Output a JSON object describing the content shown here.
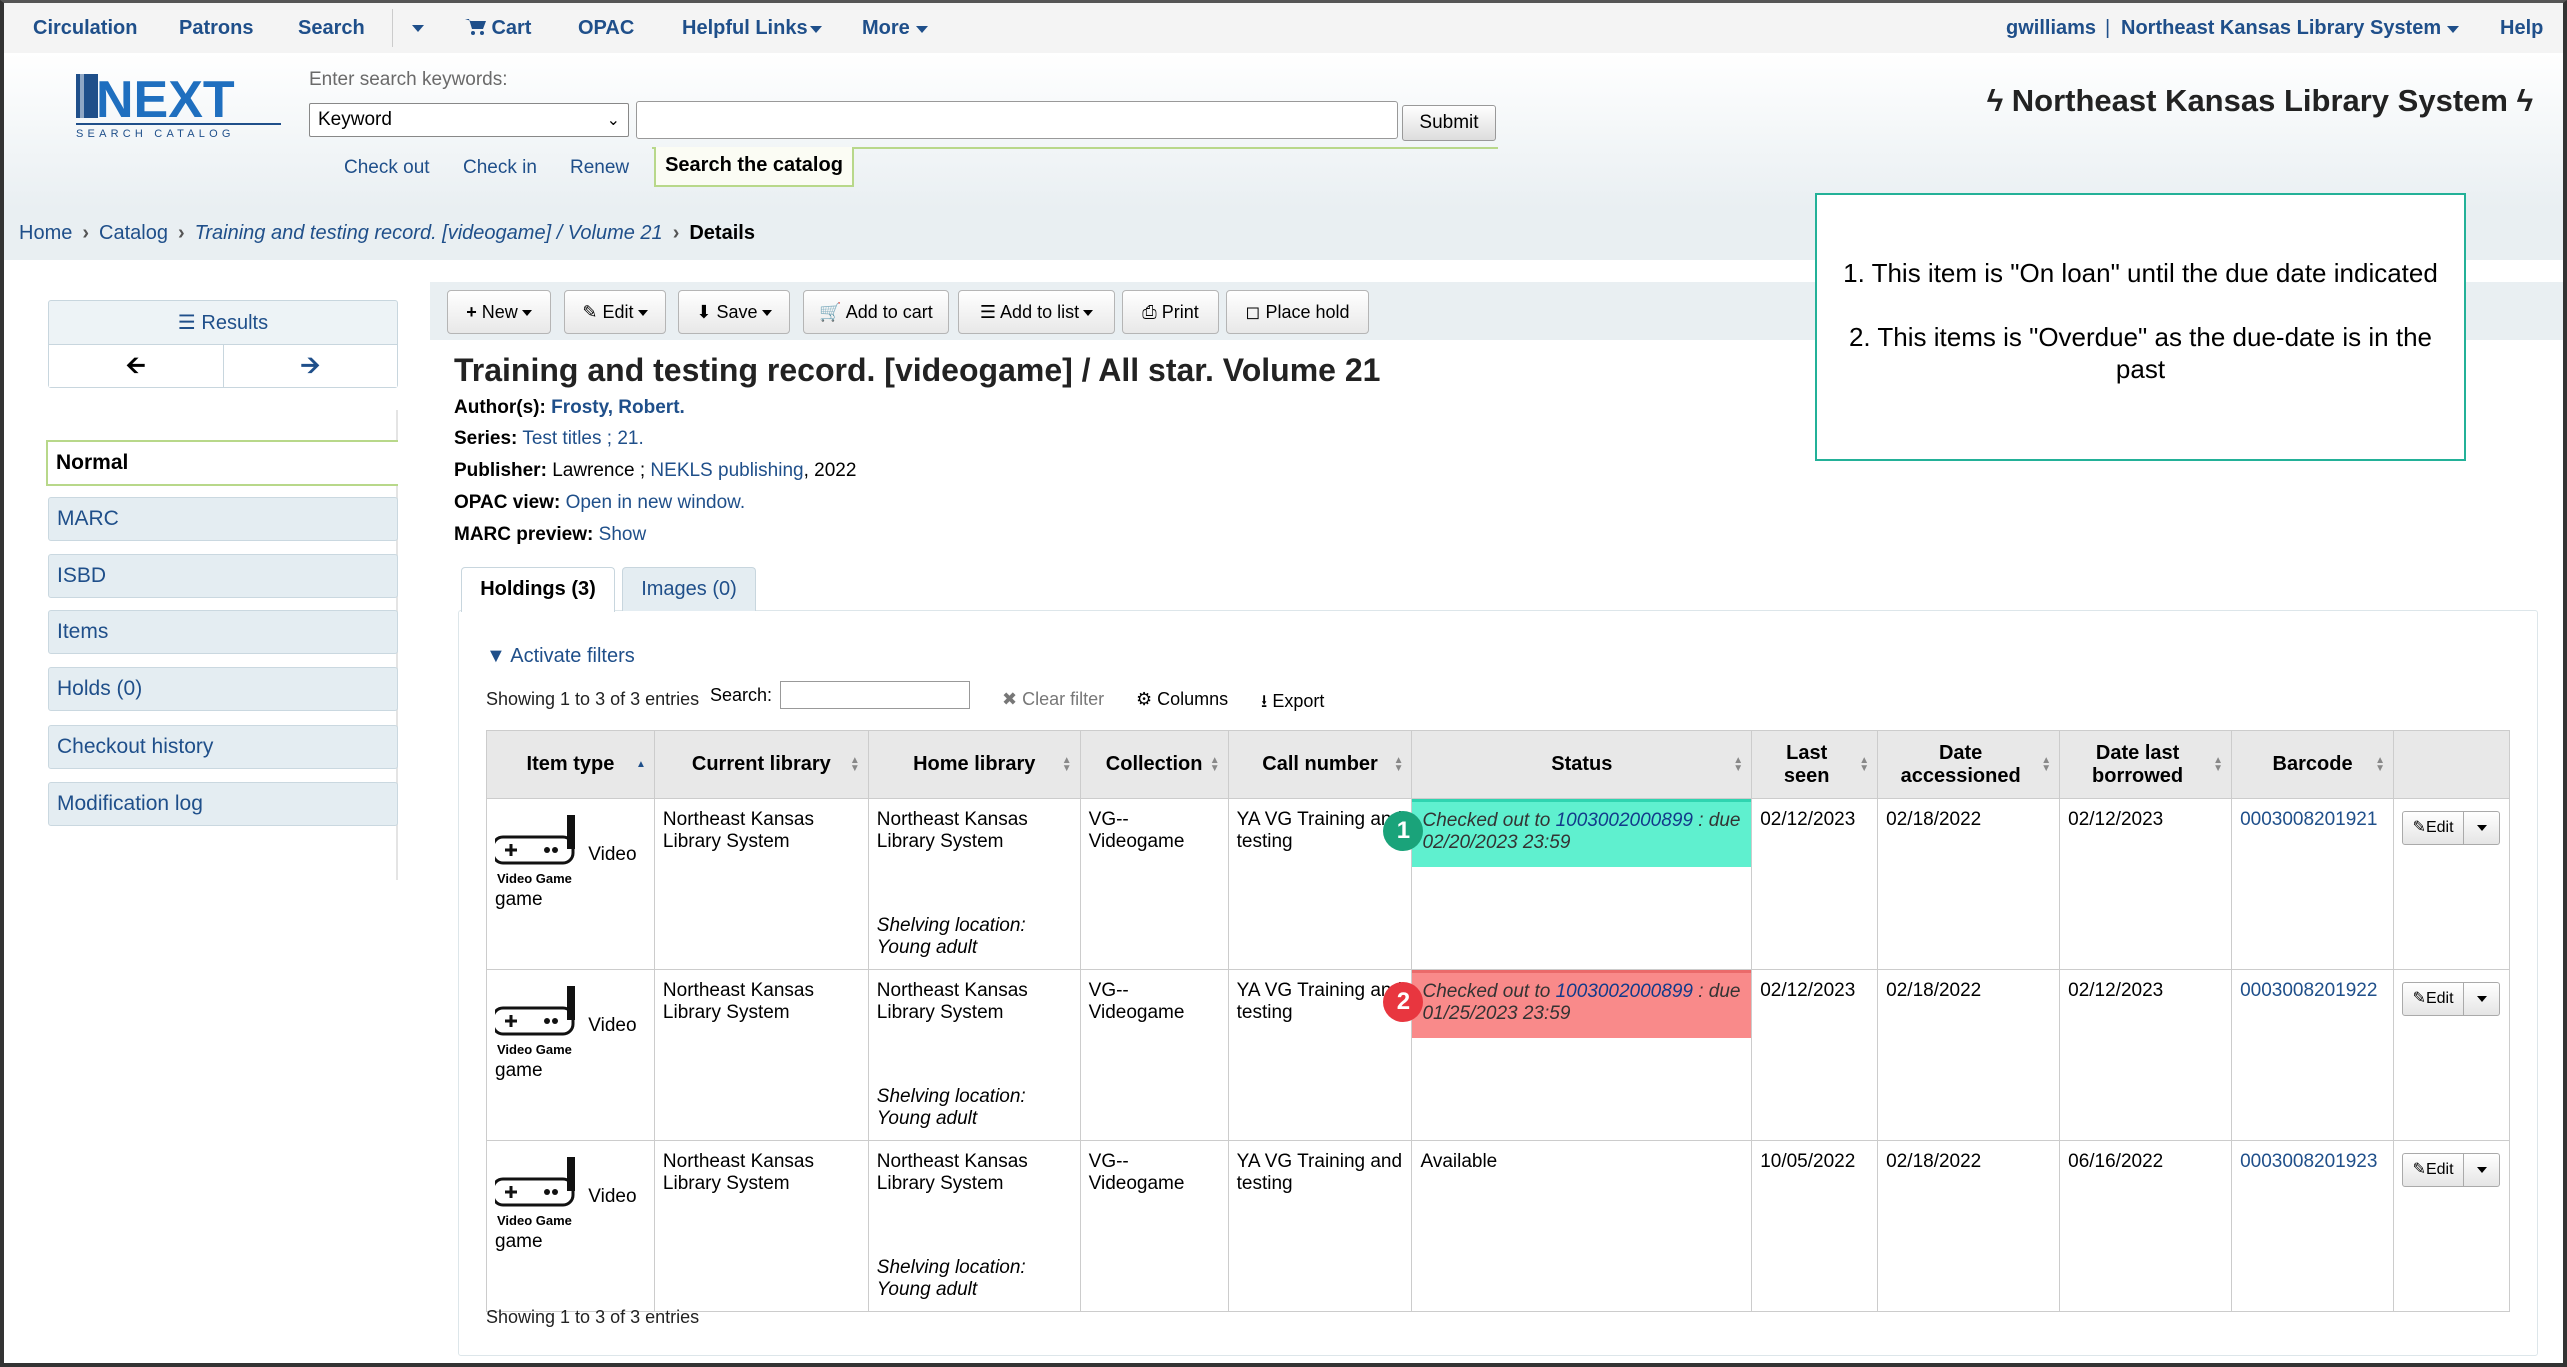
{
  "nav": {
    "left": [
      "Circulation",
      "Patrons",
      "Search",
      "Cart",
      "OPAC",
      "Helpful Links",
      "More"
    ],
    "user": "gwilliams",
    "sep": "|",
    "library": "Northeast Kansas Library System",
    "help": "Help"
  },
  "header": {
    "logo_text": "NEXT",
    "logo_sub": "SEARCH CATALOG",
    "search_label": "Enter search keywords:",
    "search_type": "Keyword",
    "submit": "Submit",
    "subnav": [
      "Check out",
      "Check in",
      "Renew"
    ],
    "search_tab": "Search the catalog",
    "library_title": "Northeast Kansas Library System"
  },
  "breadcrumb": {
    "home": "Home",
    "catalog": "Catalog",
    "record": "Training and testing record. [videogame] / Volume 21",
    "current": "Details"
  },
  "note": {
    "line1": "1. This item is \"On loan\" until the due date indicated",
    "line2": "2. This items is \"Overdue\" as the due-date is in the past"
  },
  "sidebar": {
    "results": "Results",
    "items": [
      "Normal",
      "MARC",
      "ISBD",
      "Items",
      "Holds (0)",
      "Checkout history",
      "Modification log"
    ]
  },
  "toolbar": {
    "new": "New",
    "edit": "Edit",
    "save": "Save",
    "add_cart": "Add to cart",
    "add_list": "Add to list",
    "print": "Print",
    "place_hold": "Place hold"
  },
  "record": {
    "title": "Training and testing record. [videogame] / All star. Volume 21",
    "author_label": "Author(s):",
    "author": "Frosty, Robert.",
    "series_label": "Series:",
    "series": "Test titles ; 21.",
    "publisher_label": "Publisher:",
    "publisher_place": "Lawrence ;",
    "publisher_name": "NEKLS publishing",
    "publisher_year": ", 2022",
    "opac_label": "OPAC view:",
    "opac_link": "Open in new window.",
    "marc_label": "MARC preview:",
    "marc_link": "Show"
  },
  "tabs": [
    "Holdings (3)",
    "Images (0)"
  ],
  "holdings": {
    "activate_filters": "Activate filters",
    "showing": "Showing 1 to 3 of 3 entries",
    "search_label": "Search:",
    "clear_filter": "Clear filter",
    "columns": "Columns",
    "export": "Export",
    "headers": [
      "Item type",
      "Current library",
      "Home library",
      "Collection",
      "Call number",
      "Status",
      "Last seen",
      "Date accessioned",
      "Date last borrowed",
      "Barcode",
      ""
    ],
    "rows": [
      {
        "icon_label": "Video Game",
        "item_type_a": "Video",
        "item_type_b": "game",
        "current": "Northeast Kansas Library System",
        "home": "Northeast Kansas Library System",
        "shelving": "Shelving location: Young adult",
        "collection": "VG--Videogame",
        "callnum": "YA VG Training and testing",
        "status_prefix": "Checked out to",
        "status_card": "1003002000899",
        "status_due": ": due 02/20/2023 23:59",
        "badge": "1",
        "last_seen": "02/12/2023",
        "accessioned": "02/18/2022",
        "last_borrowed": "02/12/2023",
        "barcode": "0003008201921",
        "edit": "Edit"
      },
      {
        "icon_label": "Video Game",
        "item_type_a": "Video",
        "item_type_b": "game",
        "current": "Northeast Kansas Library System",
        "home": "Northeast Kansas Library System",
        "shelving": "Shelving location: Young adult",
        "collection": "VG--Videogame",
        "callnum": "YA VG Training and testing",
        "status_prefix": "Checked out to",
        "status_card": "1003002000899",
        "status_due": ": due 01/25/2023 23:59",
        "badge": "2",
        "last_seen": "02/12/2023",
        "accessioned": "02/18/2022",
        "last_borrowed": "02/12/2023",
        "barcode": "0003008201922",
        "edit": "Edit"
      },
      {
        "icon_label": "Video Game",
        "item_type_a": "Video",
        "item_type_b": "game",
        "current": "Northeast Kansas Library System",
        "home": "Northeast Kansas Library System",
        "shelving": "Shelving location: Young adult",
        "collection": "VG--Videogame",
        "callnum": "YA VG Training and testing",
        "status": "Available",
        "last_seen": "10/05/2022",
        "accessioned": "02/18/2022",
        "last_borrowed": "06/16/2022",
        "barcode": "0003008201923",
        "edit": "Edit"
      }
    ]
  },
  "colors": {
    "link": "#1f4f8a",
    "on_loan": "#5ff0cf",
    "overdue": "#f98a8a",
    "badge_green": "#1aa37a",
    "badge_red": "#e8363f"
  }
}
